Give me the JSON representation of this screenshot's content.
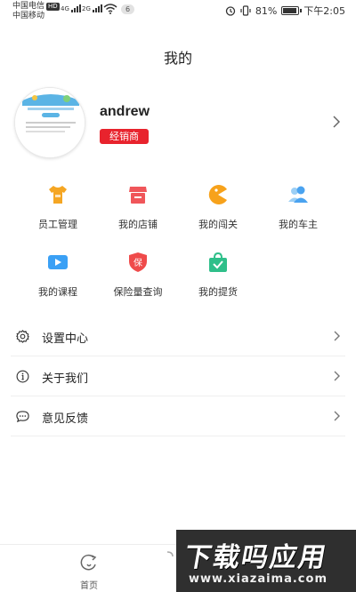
{
  "statusbar": {
    "carrier1": "中国电信",
    "hd": "HD",
    "carrier2": "中国移动",
    "sig1": "4G",
    "sig2": "2G",
    "notifications": "6",
    "battery": "81%",
    "time": "下午2:05",
    "icons": [
      "alarm-icon",
      "vibrate-icon",
      "battery-icon",
      "wifi-icon",
      "signal-icon"
    ]
  },
  "page": {
    "title": "我的"
  },
  "profile": {
    "name": "andrew",
    "role_badge": "经销商",
    "badge_color": "#e8232d"
  },
  "grid": {
    "items": [
      {
        "label": "员工管理",
        "icon": "tshirt-icon",
        "color": "#f5a623"
      },
      {
        "label": "我的店铺",
        "icon": "store-icon",
        "color": "#f0565a"
      },
      {
        "label": "我的闯关",
        "icon": "pacman-icon",
        "color": "#f7a21b"
      },
      {
        "label": "我的车主",
        "icon": "users-icon",
        "color": "#4aa3f0"
      },
      {
        "label": "我的课程",
        "icon": "video-icon",
        "color": "#3aa0f5"
      },
      {
        "label": "保险量查询",
        "icon": "shield-icon",
        "color": "#ef4b4b",
        "icon_text": "保"
      },
      {
        "label": "我的提货",
        "icon": "bag-icon",
        "color": "#2fbf8a"
      }
    ]
  },
  "menu": {
    "items": [
      {
        "label": "设置中心",
        "icon": "gear-icon"
      },
      {
        "label": "关于我们",
        "icon": "info-icon"
      },
      {
        "label": "意见反馈",
        "icon": "message-icon"
      }
    ]
  },
  "tabbar": {
    "home_label": "首页"
  },
  "watermark": {
    "big": "下载吗应用",
    "small": "www.xiazaima.com"
  }
}
